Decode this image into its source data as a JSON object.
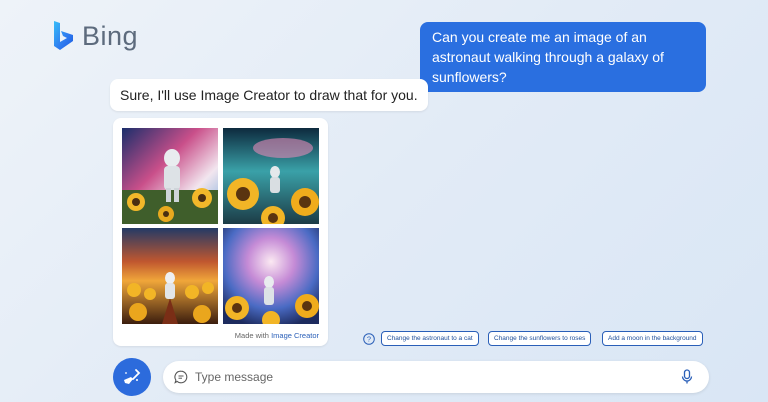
{
  "brand": {
    "name": "Bing"
  },
  "conversation": {
    "user_message": "Can you create me an image of an astronaut walking through a galaxy of sunflowers?",
    "bot_message": "Sure, I'll use Image Creator to draw that for you.",
    "image_card": {
      "footer_prefix": "Made with",
      "footer_link": "Image Creator",
      "images": [
        "astronaut-sunflowers-image-1",
        "astronaut-sunflowers-image-2",
        "astronaut-sunflowers-image-3",
        "astronaut-sunflowers-image-4"
      ]
    }
  },
  "suggestions": [
    "Change the astronaut to a cat",
    "Change the sunflowers to roses",
    "Add a moon in the background"
  ],
  "input": {
    "placeholder": "Type message",
    "value": ""
  },
  "icons": {
    "logo": "bing-logo-icon",
    "help": "help-icon",
    "new_topic": "broom-icon",
    "chat": "chat-icon",
    "mic": "microphone-icon"
  },
  "colors": {
    "accent": "#2a6fe0",
    "new_topic_button": "#2c6bdc",
    "chip_border": "#2a5fb8"
  }
}
